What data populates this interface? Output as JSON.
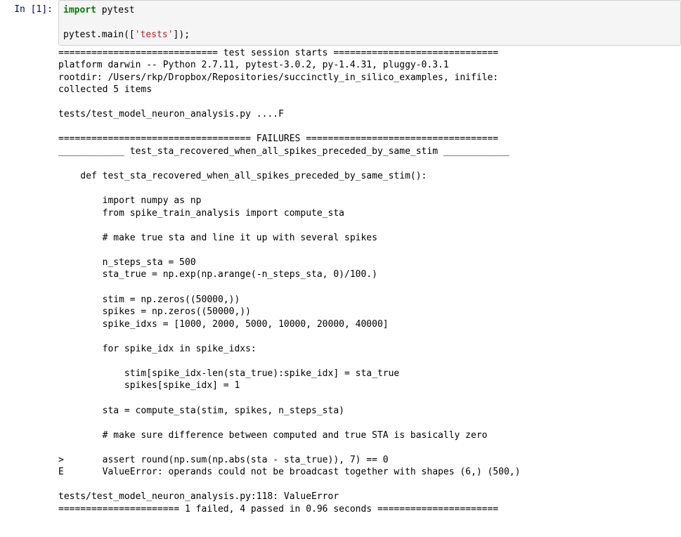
{
  "prompt": "In [1]:",
  "code": {
    "import_kw": "import",
    "import_mod": " pytest",
    "call_prefix": "pytest.main([",
    "call_arg": "'tests'",
    "call_suffix": "]);"
  },
  "output_lines": [
    "============================= test session starts ==============================",
    "platform darwin -- Python 2.7.11, pytest-3.0.2, py-1.4.31, pluggy-0.3.1",
    "rootdir: /Users/rkp/Dropbox/Repositories/succinctly_in_silico_examples, inifile:",
    "collected 5 items",
    "",
    "tests/test_model_neuron_analysis.py ....F",
    "",
    "=================================== FAILURES ===================================",
    "____________ test_sta_recovered_when_all_spikes_preceded_by_same_stim ____________",
    "",
    "    def test_sta_recovered_when_all_spikes_preceded_by_same_stim():",
    "",
    "        import numpy as np",
    "        from spike_train_analysis import compute_sta",
    "",
    "        # make true sta and line it up with several spikes",
    "",
    "        n_steps_sta = 500",
    "        sta_true = np.exp(np.arange(-n_steps_sta, 0)/100.)",
    "",
    "        stim = np.zeros((50000,))",
    "        spikes = np.zeros((50000,))",
    "        spike_idxs = [1000, 2000, 5000, 10000, 20000, 40000]",
    "",
    "        for spike_idx in spike_idxs:",
    "",
    "            stim[spike_idx-len(sta_true):spike_idx] = sta_true",
    "            spikes[spike_idx] = 1",
    "",
    "        sta = compute_sta(stim, spikes, n_steps_sta)",
    "",
    "        # make sure difference between computed and true STA is basically zero",
    "",
    ">       assert round(np.sum(np.abs(sta - sta_true)), 7) == 0",
    "E       ValueError: operands could not be broadcast together with shapes (6,) (500,)",
    "",
    "tests/test_model_neuron_analysis.py:118: ValueError",
    "====================== 1 failed, 4 passed in 0.96 seconds ======================"
  ]
}
